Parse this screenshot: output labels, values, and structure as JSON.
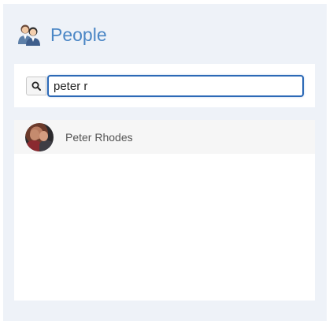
{
  "header": {
    "title": "People",
    "icon": "people-icon"
  },
  "search": {
    "value": "peter r",
    "icon": "search-icon"
  },
  "results": [
    {
      "name": "Peter Rhodes",
      "avatar": "avatar-photo"
    }
  ],
  "colors": {
    "panel_bg": "#eef2f8",
    "title": "#4a86c5",
    "input_border": "#2c69b6"
  }
}
